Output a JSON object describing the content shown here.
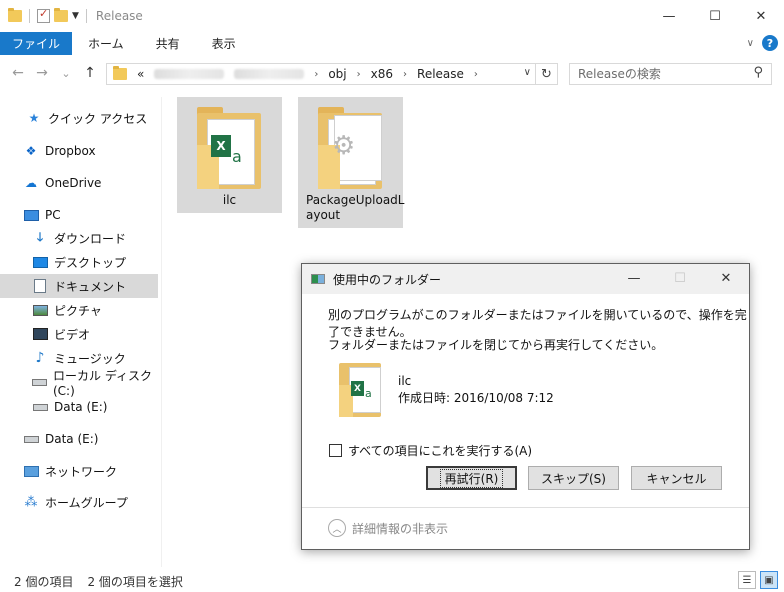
{
  "window": {
    "title": "Release",
    "minimize": "—",
    "maximize": "☐",
    "close": "✕"
  },
  "ribbon": {
    "file": "ファイル",
    "tabs": [
      "ホーム",
      "共有",
      "表示"
    ],
    "help": "?"
  },
  "nav": {
    "back": "←",
    "forward": "→",
    "recent": "⌄",
    "up": "↑"
  },
  "address": {
    "prefix": "«",
    "segments": [
      "obj",
      "x86",
      "Release"
    ],
    "refresh": "↻"
  },
  "search": {
    "placeholder": "Releaseの検索"
  },
  "sidebar": {
    "items": [
      {
        "label": "クイック アクセス",
        "icon": "star-icon"
      },
      {
        "label": "Dropbox",
        "icon": "dropbox-icon"
      },
      {
        "label": "OneDrive",
        "icon": "cloud-icon"
      },
      {
        "label": "PC",
        "icon": "computer-icon"
      },
      {
        "label": "ダウンロード",
        "icon": "download-icon"
      },
      {
        "label": "デスクトップ",
        "icon": "desktop-icon"
      },
      {
        "label": "ドキュメント",
        "icon": "document-icon"
      },
      {
        "label": "ピクチャ",
        "icon": "pictures-icon"
      },
      {
        "label": "ビデオ",
        "icon": "video-icon"
      },
      {
        "label": "ミュージック",
        "icon": "music-icon"
      },
      {
        "label": "ローカル ディスク (C:)",
        "icon": "disk-icon"
      },
      {
        "label": "Data (E:)",
        "icon": "disk-icon"
      },
      {
        "label": "Data (E:)",
        "icon": "disk-icon"
      },
      {
        "label": "ネットワーク",
        "icon": "network-icon"
      },
      {
        "label": "ホームグループ",
        "icon": "homegroup-icon"
      }
    ]
  },
  "files": [
    {
      "name": "ilc"
    },
    {
      "name_line1": "PackageUploadL",
      "name_line2": "ayout"
    }
  ],
  "status": {
    "count": "2 個の項目",
    "selected": "2 個の項目を選択"
  },
  "dialog": {
    "title": "使用中のフォルダー",
    "message1": "別のプログラムがこのフォルダーまたはファイルを開いているので、操作を完了できません。",
    "message2": "フォルダーまたはファイルを閉じてから再実行してください。",
    "file_name": "ilc",
    "file_date": "作成日時: 2016/10/08 7:12",
    "checkbox_label": "すべての項目にこれを実行する(A)",
    "retry": "再試行(R)",
    "skip": "スキップ(S)",
    "cancel": "キャンセル",
    "details": "詳細情報の非表示"
  },
  "colors": {
    "accent": "#1979ca",
    "selection": "#d9d9d9",
    "excel_green": "#217346",
    "folder": "#e9c16b"
  }
}
